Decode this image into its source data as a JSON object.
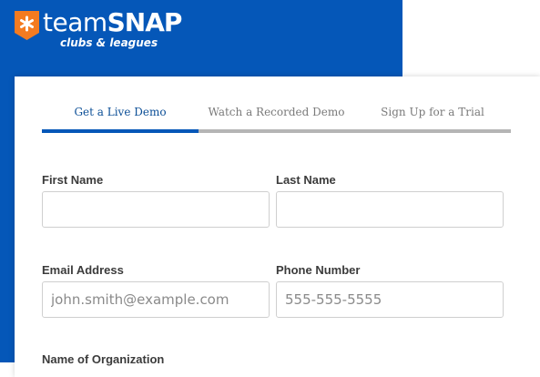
{
  "brand": {
    "name_light": "team",
    "name_bold": "SNAP",
    "tagline": "clubs & leagues",
    "badge_color": "#f47b20",
    "hero_color": "#0557b8"
  },
  "tabs": [
    {
      "label": "Get a Live Demo",
      "active": true
    },
    {
      "label": "Watch a Recorded Demo",
      "active": false
    },
    {
      "label": "Sign Up for a Trial",
      "active": false
    }
  ],
  "form": {
    "first_name": {
      "label": "First Name",
      "value": "",
      "placeholder": ""
    },
    "last_name": {
      "label": "Last Name",
      "value": "",
      "placeholder": ""
    },
    "email": {
      "label": "Email Address",
      "value": "",
      "placeholder": "john.smith@example.com"
    },
    "phone": {
      "label": "Phone Number",
      "value": "",
      "placeholder": "555-555-5555"
    },
    "organization": {
      "label": "Name of Organization"
    }
  }
}
